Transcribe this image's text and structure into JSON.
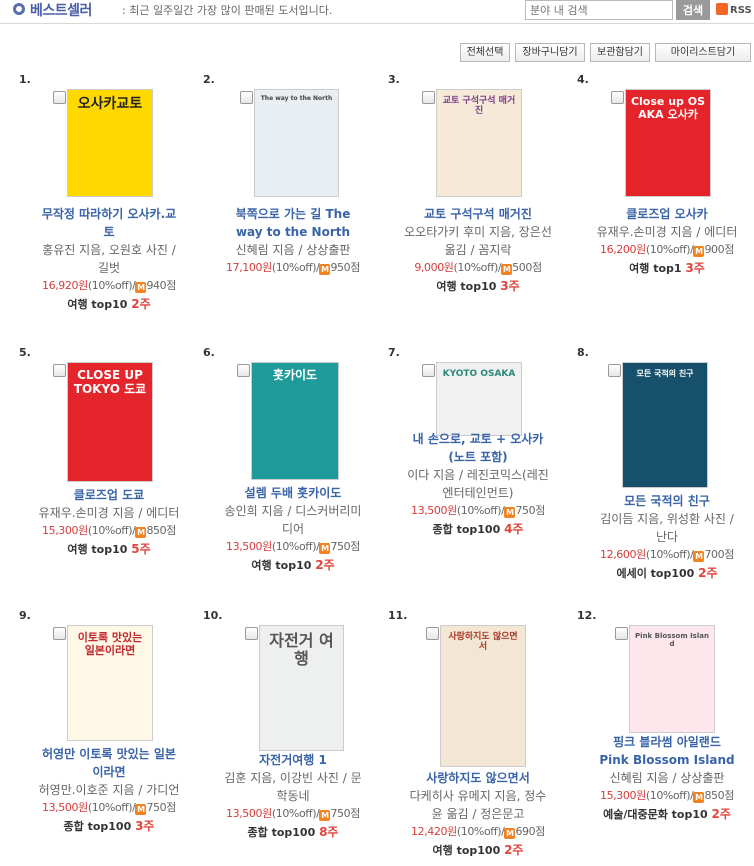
{
  "header": {
    "title": "베스트셀러",
    "description": ": 최근 일주일간 가장 많이 판매된 도서입니다.",
    "search_placeholder": "분야 내 검색",
    "search_button": "검색",
    "rss_label": "RSS"
  },
  "actions": [
    "전체선택",
    "장바구니담기",
    "보관함담기",
    "마이리스트담기"
  ],
  "books": [
    {
      "rank": "1.",
      "title": [
        "무작정 따라하기 오사카.교",
        "토"
      ],
      "author": [
        "홍유진 지음, 오원호 사진 /",
        "길벗"
      ],
      "price": "16,920원",
      "discount": "(10%off)/",
      "points": "940점",
      "category": "여행  top10",
      "weeks": "2주",
      "cover_text": "오사카교토"
    },
    {
      "rank": "2.",
      "title": [
        "북쪽으로 가는 길 The",
        "way to the North"
      ],
      "author": [
        "신혜림 지음 / 상상출판"
      ],
      "price": "17,100원",
      "discount": "(10%off)/",
      "points": "950점",
      "category": "",
      "weeks": "",
      "cover_text": "The way to the North"
    },
    {
      "rank": "3.",
      "title": [
        "교토 구석구석 매거진"
      ],
      "author": [
        "오오타가키 후미 지음, 장은선",
        "옮김 / 꼼지락"
      ],
      "price": "9,000원",
      "discount": "(10%off)/",
      "points": "500점",
      "category": "여행  top10",
      "weeks": "3주",
      "cover_text": "교토 구석구석 매거진"
    },
    {
      "rank": "4.",
      "title": [
        "클로즈업 오사카"
      ],
      "author": [
        "유재우.손미경 지음 / 에디터"
      ],
      "price": "16,200원",
      "discount": "(10%off)/",
      "points": "900점",
      "category": "여행  top1",
      "weeks": "3주",
      "cover_text": "Close up OSAKA 오사카"
    },
    {
      "rank": "5.",
      "title": [
        "클로즈업 도쿄"
      ],
      "author": [
        "유재우.손미경 지음 / 에디터"
      ],
      "price": "15,300원",
      "discount": "(10%off)/",
      "points": "850점",
      "category": "여행  top10",
      "weeks": "5주",
      "cover_text": "CLOSE UP TOKYO 도쿄"
    },
    {
      "rank": "6.",
      "title": [
        "설렘 두배 홋카이도"
      ],
      "author": [
        "송인희 지음 / 디스커버리미",
        "디어"
      ],
      "price": "13,500원",
      "discount": "(10%off)/",
      "points": "750점",
      "category": "여행  top10",
      "weeks": "2주",
      "cover_text": "홋카이도"
    },
    {
      "rank": "7.",
      "title": [
        "내 손으로, 교토 + 오사카",
        "(노트 포함)"
      ],
      "author": [
        "이다 지음 / 레진코믹스(레진",
        "엔터테인먼트)"
      ],
      "price": "13,500원",
      "discount": "(10%off)/",
      "points": "750점",
      "category": "종합  top100",
      "weeks": "4주",
      "cover_text": "KYOTO OSAKA"
    },
    {
      "rank": "8.",
      "title": [
        "모든 국적의 친구"
      ],
      "author": [
        "김이듬 지음, 위성환 사진 /",
        "난다"
      ],
      "price": "12,600원",
      "discount": "(10%off)/",
      "points": "700점",
      "category": "에세이  top100",
      "weeks": "2주",
      "cover_text": "모든 국적의 친구"
    },
    {
      "rank": "9.",
      "title": [
        "허영만 이토록 맛있는 일본",
        "이라면"
      ],
      "author": [
        "허영만.이호준 지음 / 가디언"
      ],
      "price": "13,500원",
      "discount": "(10%off)/",
      "points": "750점",
      "category": "종합  top100",
      "weeks": "3주",
      "cover_text": "이토록 맛있는 일본이라면"
    },
    {
      "rank": "10.",
      "title": [
        "자전거여행 1"
      ],
      "author": [
        "김훈 지음, 이강빈 사진 / 문",
        "학동네"
      ],
      "price": "13,500원",
      "discount": "(10%off)/",
      "points": "750점",
      "category": "종합  top100",
      "weeks": "8주",
      "cover_text": "자전거 여행"
    },
    {
      "rank": "11.",
      "title": [
        "사랑하지도 않으면서"
      ],
      "author": [
        "다케히사 유메지 지음, 정수",
        "윤 옮김 / 정은문고"
      ],
      "price": "12,420원",
      "discount": "(10%off)/",
      "points": "690점",
      "category": "여행  top100",
      "weeks": "2주",
      "cover_text": "사랑하지도 않으면서"
    },
    {
      "rank": "12.",
      "title": [
        "핑크 블라썸 아일랜드",
        "Pink Blossom Island"
      ],
      "author": [
        "신혜림 지음 / 상상출판"
      ],
      "price": "15,300원",
      "discount": "(10%off)/",
      "points": "850점",
      "category": "예술/대중문화  top10",
      "weeks": "2주",
      "cover_text": "Pink Blossom Island"
    }
  ],
  "point_icon": "M",
  "colors": {
    "title": "#3a64a8",
    "price": "#d43d3d",
    "weeks": "#e0453d",
    "header": "#4a5ea8"
  }
}
